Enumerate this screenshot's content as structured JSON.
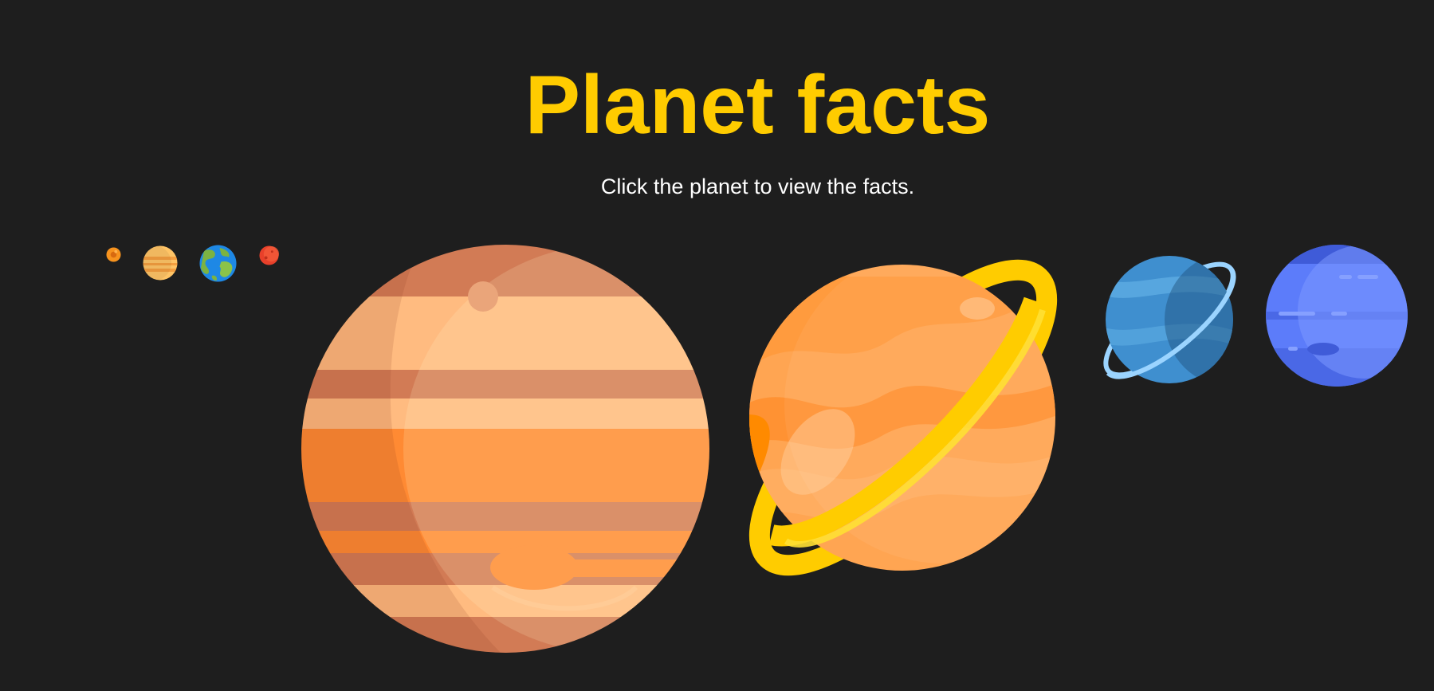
{
  "page": {
    "title": "Planet facts",
    "subtitle": "Click the planet to view the facts."
  },
  "planets": [
    {
      "id": "mercury",
      "icon": "mercury-icon",
      "color": "#f7931e"
    },
    {
      "id": "venus",
      "icon": "venus-icon",
      "color": "#ffc466"
    },
    {
      "id": "earth",
      "icon": "earth-icon",
      "color": "#1e88e5"
    },
    {
      "id": "mars",
      "icon": "mars-icon",
      "color": "#e8402a"
    },
    {
      "id": "jupiter",
      "icon": "jupiter-icon",
      "color": "#ff8a33"
    },
    {
      "id": "saturn",
      "icon": "saturn-icon",
      "color": "#ffa552"
    },
    {
      "id": "uranus",
      "icon": "uranus-icon",
      "color": "#3f8fcf"
    },
    {
      "id": "neptune",
      "icon": "neptune-icon",
      "color": "#5c7cfa"
    }
  ],
  "colors": {
    "background": "#1e1e1e",
    "title": "#ffcc00",
    "subtitle": "#ffffff"
  }
}
